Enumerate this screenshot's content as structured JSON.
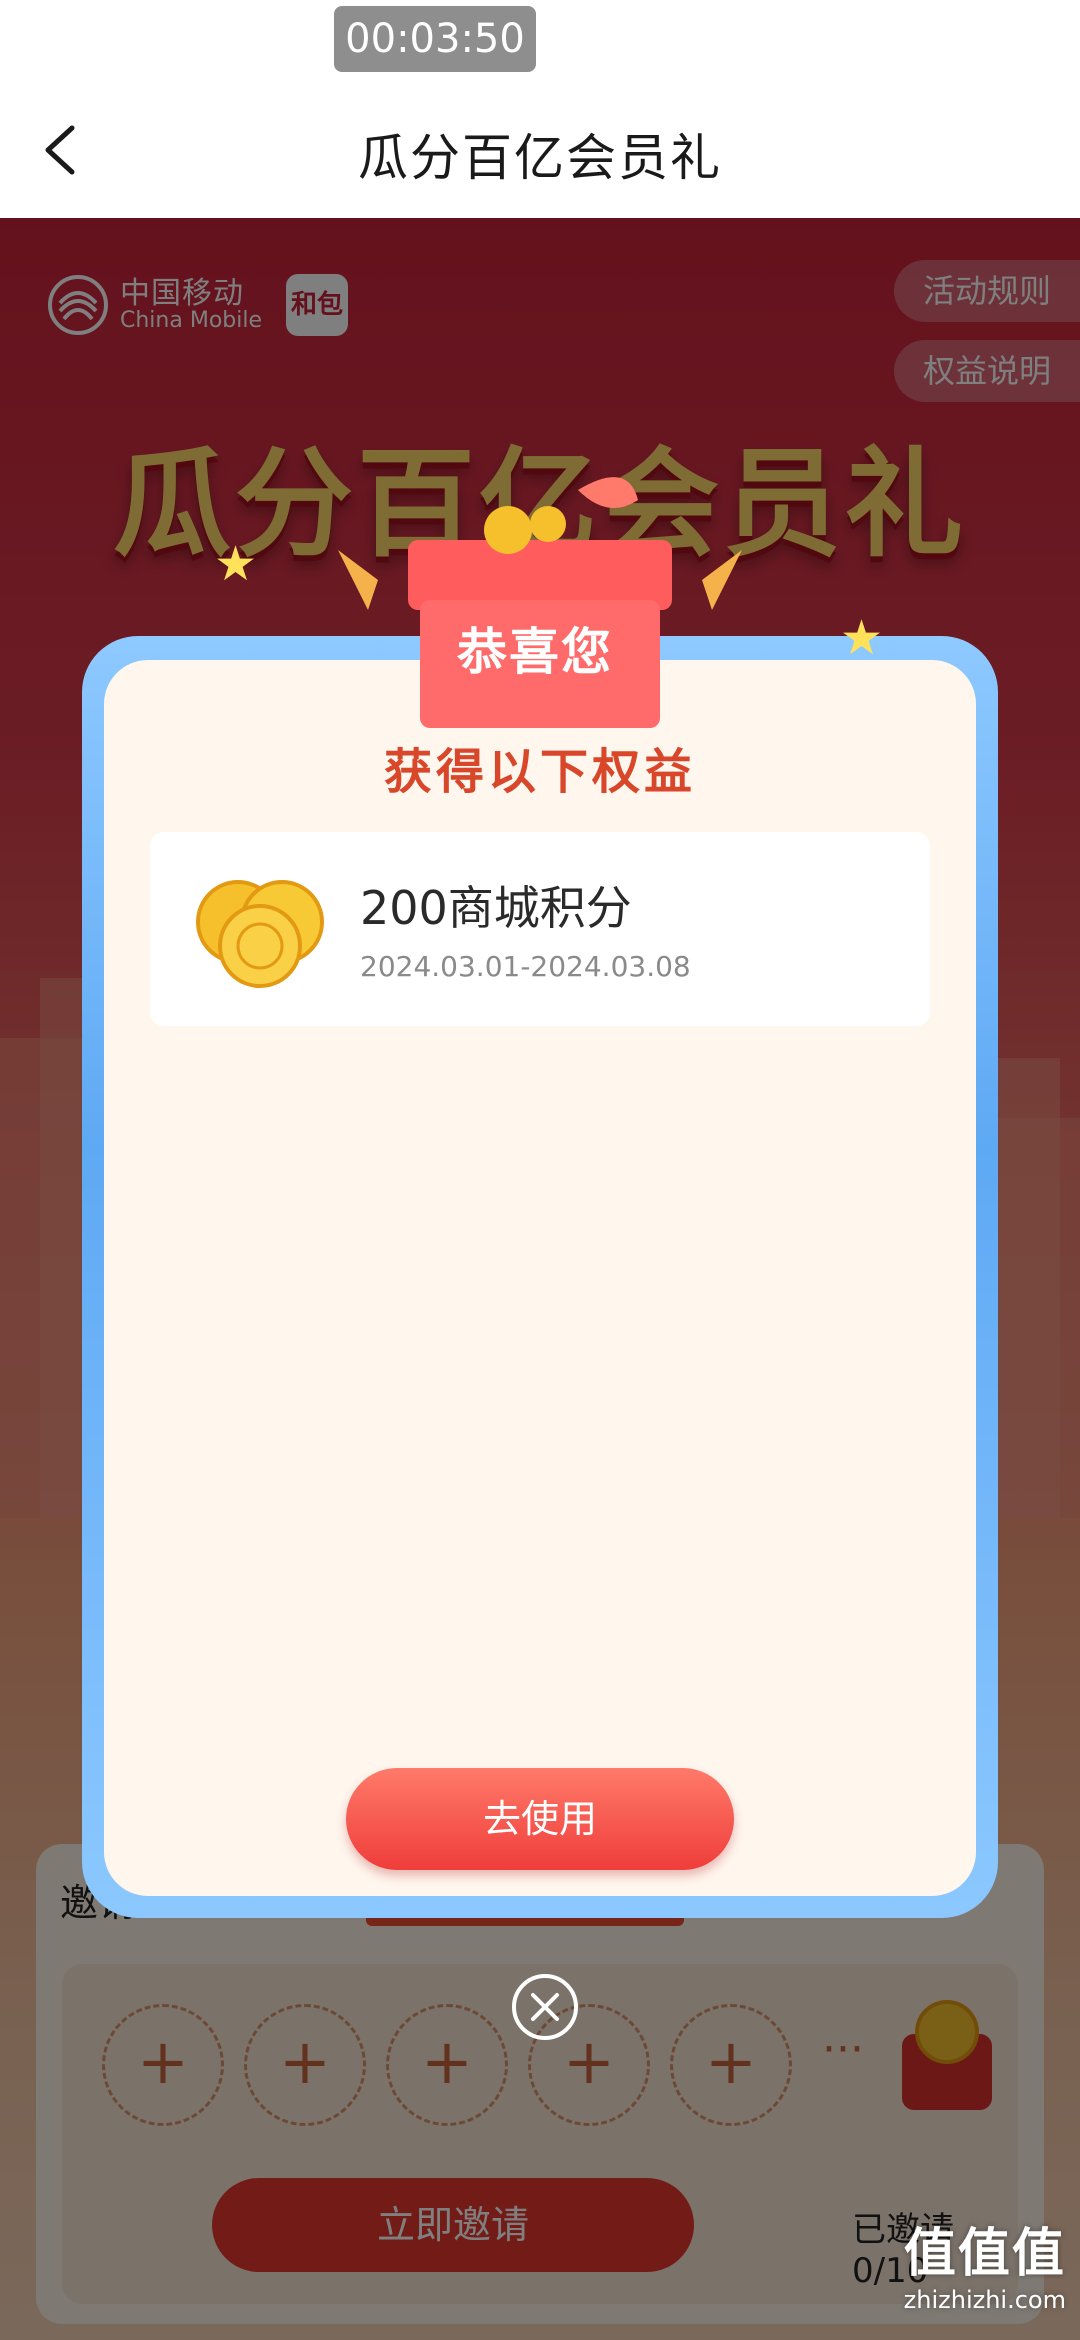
{
  "status": {
    "timer": "00:03:50"
  },
  "header": {
    "title": "瓜分百亿会员礼"
  },
  "background": {
    "logo_cn": "中国移动",
    "logo_en": "China Mobile",
    "hebao_label": "和包",
    "rules_button": "活动规则",
    "equity_button": "权益说明",
    "hero_title": "瓜分百亿会员礼",
    "invite_title": "邀请",
    "invite_button": "立即邀请",
    "invited_count": "已邀请0/10",
    "slot_symbol": "+",
    "more_dots": "···"
  },
  "modal": {
    "badge": "恭喜您",
    "subtitle": "获得以下权益",
    "reward": {
      "name": "200商城积分",
      "date_range": "2024.03.01-2024.03.08"
    },
    "use_button": "去使用"
  },
  "watermark": {
    "cn": "值值值",
    "en": "zhizhizhi.com"
  },
  "colors": {
    "accent_red": "#e7392f",
    "modal_frame_blue": "#5ea9f4",
    "subtitle_orange": "#d9472b"
  }
}
